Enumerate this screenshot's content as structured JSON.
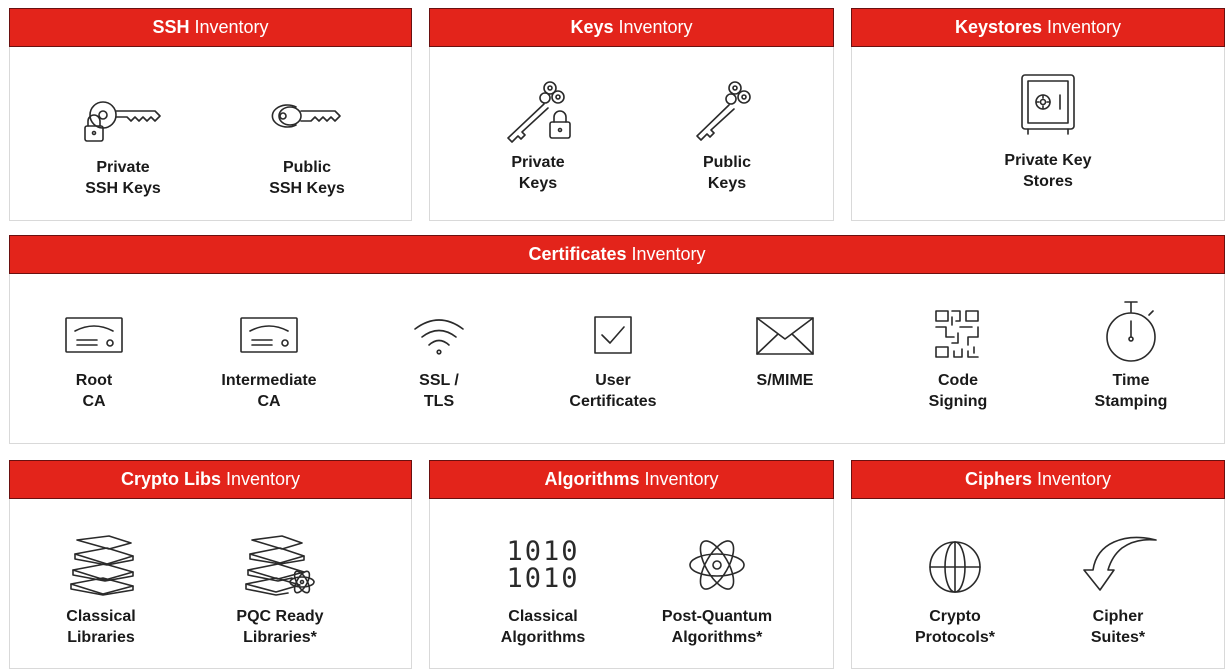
{
  "brand_color": "#e3241b",
  "panels": {
    "ssh": {
      "title_bold": "SSH",
      "title_rest": "Inventory",
      "items": [
        {
          "icon": "locked-key-icon",
          "label": "Private\nSSH Keys"
        },
        {
          "icon": "key-icon",
          "label": "Public\nSSH Keys"
        }
      ]
    },
    "keys": {
      "title_bold": "Keys",
      "title_rest": "Inventory",
      "items": [
        {
          "icon": "locked-skeleton-key-icon",
          "label": "Private\nKeys"
        },
        {
          "icon": "skeleton-key-icon",
          "label": "Public\nKeys"
        }
      ]
    },
    "keystores": {
      "title_bold": "Keystores",
      "title_rest": "Inventory",
      "items": [
        {
          "icon": "safe-icon",
          "label": "Private Key\nStores"
        }
      ]
    },
    "certificates": {
      "title_bold": "Certificates",
      "title_rest": "Inventory",
      "items": [
        {
          "icon": "certificate-icon",
          "label": "Root\nCA"
        },
        {
          "icon": "certificate-icon",
          "label": "Intermediate\nCA"
        },
        {
          "icon": "wifi-icon",
          "label": "SSL /\nTLS"
        },
        {
          "icon": "checkbox-icon",
          "label": "User\nCertificates"
        },
        {
          "icon": "envelope-icon",
          "label": "S/MIME"
        },
        {
          "icon": "qr-code-icon",
          "label": "Code\nSigning"
        },
        {
          "icon": "stopwatch-icon",
          "label": "Time\nStamping"
        }
      ]
    },
    "cryptolibs": {
      "title_bold": "Crypto Libs",
      "title_rest": "Inventory",
      "items": [
        {
          "icon": "books-icon",
          "label": "Classical\nLibraries"
        },
        {
          "icon": "books-atom-icon",
          "label": "PQC Ready\nLibraries*"
        }
      ]
    },
    "algorithms": {
      "title_bold": "Algorithms",
      "title_rest": "Inventory",
      "items": [
        {
          "icon": "binary-icon",
          "label": "Classical\nAlgorithms",
          "glyph_lines": [
            "1010",
            "1010"
          ]
        },
        {
          "icon": "atom-icon",
          "label": "Post-Quantum\nAlgorithms*"
        }
      ]
    },
    "ciphers": {
      "title_bold": "Ciphers",
      "title_rest": "Inventory",
      "items": [
        {
          "icon": "globe-icon",
          "label": "Crypto\nProtocols*"
        },
        {
          "icon": "curved-arrow-icon",
          "label": "Cipher\nSuites*"
        }
      ]
    }
  }
}
